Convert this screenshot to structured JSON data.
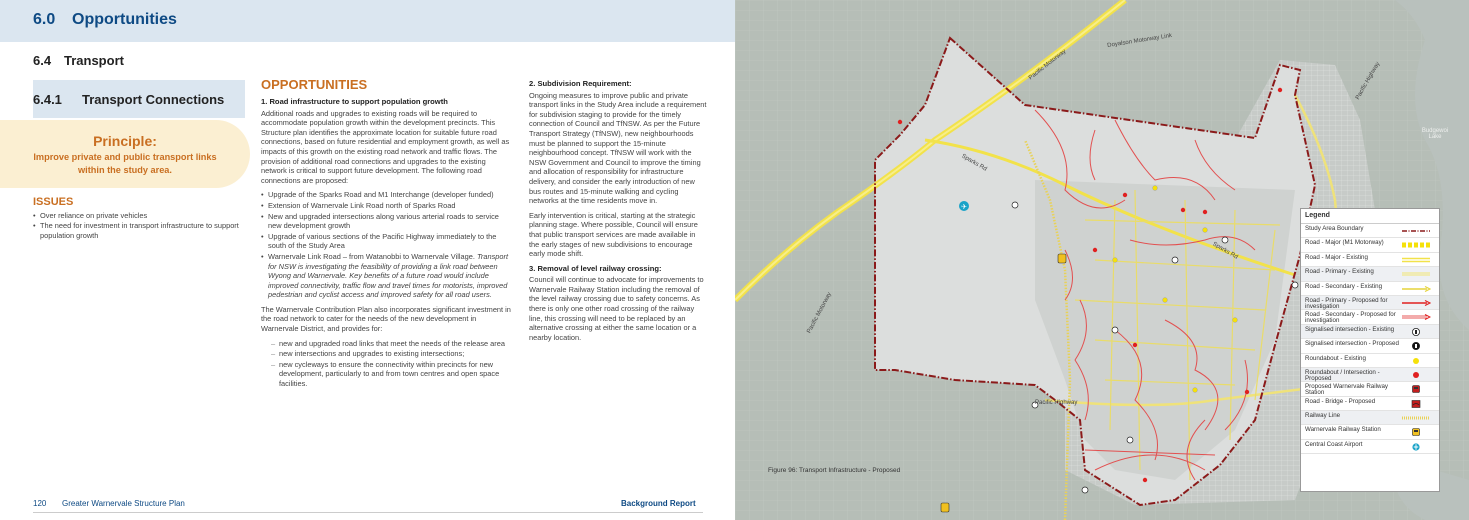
{
  "doc": {
    "header": {
      "number": "6.0",
      "title": "Opportunities"
    },
    "section": {
      "number": "6.4",
      "title": "Transport"
    },
    "subsection": {
      "number": "6.4.1",
      "title": "Transport Connections"
    },
    "principle": {
      "heading": "Principle:",
      "text": "Improve private and public transport links within the study area."
    },
    "issues": {
      "heading": "ISSUES",
      "items": [
        "Over reliance on private vehicles",
        "The need for investment in transport infrastructure to support population growth"
      ]
    },
    "opportunities": {
      "heading": "OPPORTUNITIES",
      "sub1_heading": "1. Road infrastructure to support population growth",
      "sub1_para": "Additional roads and upgrades to existing roads will be required to accommodate population growth within the development precincts. This Structure plan identifies the approximate location for suitable future road connections, based on future residential and employment growth, as well as impacts of this growth on the existing road network and traffic flows. The provision of additional road connections and upgrades to the existing network is critical to support future development. The following road connections are proposed:",
      "sub1_bullets": [
        "Upgrade of the Sparks Road and M1 Interchange (developer funded)",
        "Extension of Warnervale Link Road north of Sparks Road",
        "New and upgraded intersections along various arterial roads to service new development growth",
        "Upgrade of various sections of the Pacific Highway immediately to the south of the Study Area"
      ],
      "sub1_bullet5_lead": "Warnervale Link Road – from Watanobbi to Warnervale Village. ",
      "sub1_bullet5_italic": "Transport for NSW is investigating the feasibility of providing a link road between Wyong and Warnervale. Key benefits of a future road would include improved connectivity, traffic flow and travel times for motorists, improved pedestrian and cyclist access and improved safety for all road users.",
      "contrib_para": "The Warnervale Contribution Plan also incorporates significant investment in the road network to cater for the needs of the new development in Warnervale District, and provides for:",
      "contrib_items": [
        "new and upgraded road links that meet the needs of the release area",
        "new intersections and upgrades to existing intersections;",
        "new cycleways to ensure the connectivity within precincts for new development, particularly to and from town centres and open space facilities."
      ],
      "sub2_heading": "2. Subdivision Requirement:",
      "sub2_para1": "Ongoing measures to improve public and private transport links in the Study Area include a requirement for subdivision staging to provide for the timely connection of Council and TfNSW. As per the Future Transport Strategy (TfNSW), new neighbourhoods must be planned to support the 15-minute neighbourhood concept. TfNSW will work with the NSW Government and Council to improve the timing and allocation of responsibility for infrastructure delivery, and consider the early introduction of new bus routes and 15-minute walking and cycling networks at the time residents move in.",
      "sub2_para2": "Early intervention is critical, starting at the strategic planning stage. Where possible, Council will ensure that public transport services are made available in the early stages of new subdivisions to encourage early mode shift.",
      "sub3_heading": "3. Removal of level railway crossing:",
      "sub3_para": "Council will continue to advocate for improvements to Warnervale Railway Station including the removal of the level railway crossing due to safety concerns. As there is only one other road crossing of the railway line, this crossing will need to be replaced by an alternative crossing at either the same location or a nearby location."
    },
    "footer": {
      "page": "120",
      "title": "Greater Warnervale Structure Plan",
      "right": "Background Report"
    }
  },
  "map": {
    "labels": {
      "pacific_motorway_top": "Pacific Motorway",
      "pacific_motorway_left": "Pacific Motorway",
      "doyalson_link": "Doyalson Motorway Link",
      "pacific_highway_ne": "Pacific Highway",
      "pacific_highway_mid": "Pacific Highway",
      "sparks_rd_1": "Sparks Rd",
      "sparks_rd_2": "Sparks Rd",
      "budgewoi_lake": "Budgewoi Lake"
    },
    "caption": "Figure 96: Transport Infrastructure - Proposed",
    "legend": {
      "title": "Legend",
      "items": [
        {
          "label": "Study Area Boundary",
          "icon": "dash-dot-line",
          "color": "#8b1a1a"
        },
        {
          "label": "Road - Major (M1 Motorway)",
          "icon": "thick-dashed-line",
          "color": "#f5e10a"
        },
        {
          "label": "Road - Major - Existing",
          "icon": "double-line",
          "color": "#f2e24a"
        },
        {
          "label": "Road - Primary - Existing",
          "icon": "thin-double-line",
          "color": "#f2e24a"
        },
        {
          "label": "Road - Secondary - Existing",
          "icon": "arrow-line",
          "color": "#e5d33a"
        },
        {
          "label": "Road - Primary - Proposed for investigation",
          "icon": "arrow-line",
          "color": "#e02020"
        },
        {
          "label": "Road - Secondary - Proposed for investigation",
          "icon": "hollow-arrow-line",
          "color": "#e02020"
        },
        {
          "label": "Signalised intersection - Existing",
          "icon": "signal-icon",
          "color": "#ffffff"
        },
        {
          "label": "Signalised intersection - Proposed",
          "icon": "signal-icon",
          "color": "#111111"
        },
        {
          "label": "Roundabout - Existing",
          "icon": "dot",
          "color": "#f5e10a"
        },
        {
          "label": "Roundabout / Intersection - Proposed",
          "icon": "dot",
          "color": "#e02020"
        },
        {
          "label": "Proposed Warnervale Railway Station",
          "icon": "train-icon",
          "color": "#c41e1e"
        },
        {
          "label": "Road - Bridge - Proposed",
          "icon": "bridge-icon",
          "color": "#c41e1e"
        },
        {
          "label": "Railway Line",
          "icon": "rail-line",
          "color": "#e8d25a"
        },
        {
          "label": "Warnervale Railway Station",
          "icon": "train-icon",
          "color": "#f0c020"
        },
        {
          "label": "Central Coast Airport",
          "icon": "plane-icon",
          "color": "#1aa3c8"
        }
      ]
    }
  }
}
